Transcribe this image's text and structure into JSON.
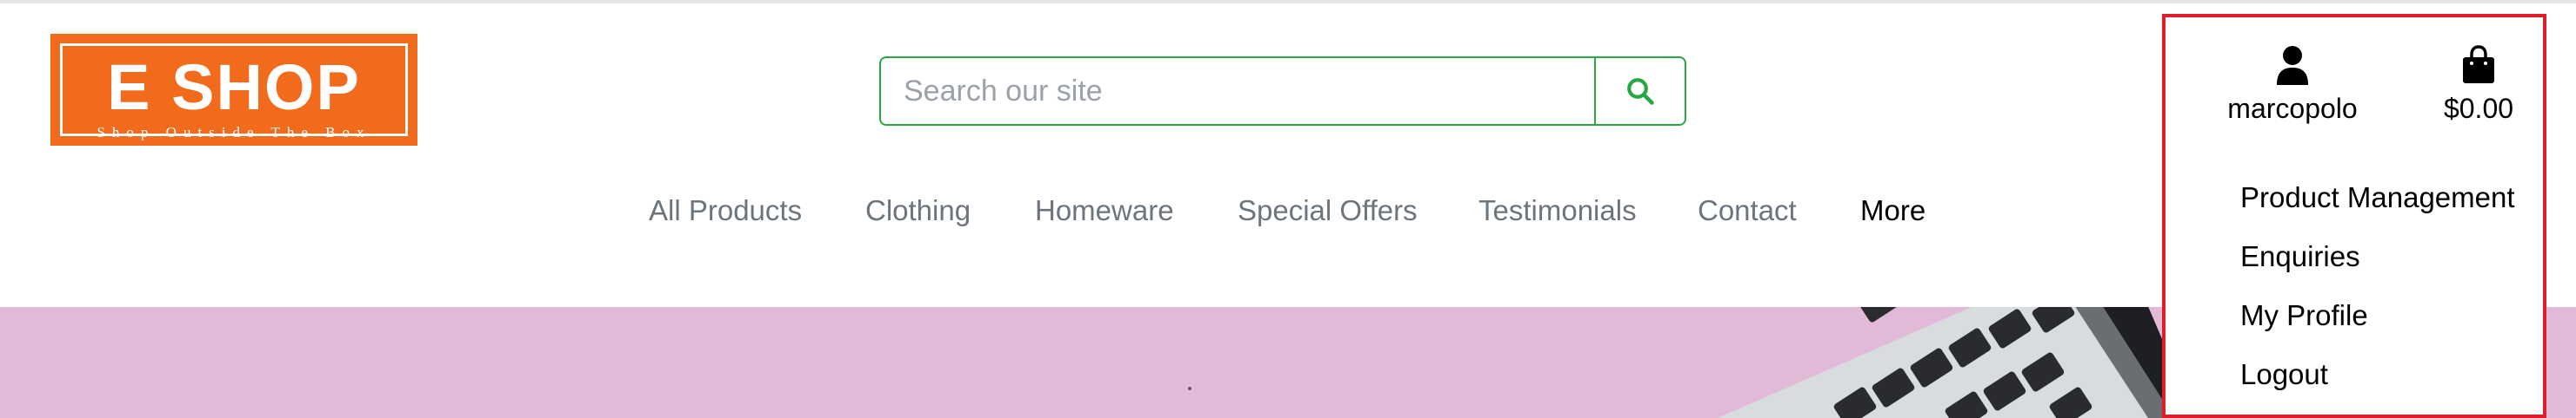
{
  "logo": {
    "title": "E SHOP",
    "tagline": "Shop Outside The Box",
    "brand_color": "#f26b1d"
  },
  "search": {
    "placeholder": "Search our site",
    "value": "",
    "button_icon": "search-icon",
    "accent_color": "#28a745"
  },
  "nav": {
    "items": [
      {
        "label": "All Products"
      },
      {
        "label": "Clothing"
      },
      {
        "label": "Homeware"
      },
      {
        "label": "Special Offers"
      },
      {
        "label": "Testimonials"
      },
      {
        "label": "Contact"
      },
      {
        "label": "More"
      }
    ]
  },
  "account": {
    "icon": "user-icon",
    "username": "marcopolo",
    "menu": [
      {
        "label": "Product Management"
      },
      {
        "label": "Enquiries"
      },
      {
        "label": "My Profile"
      },
      {
        "label": "Logout"
      }
    ]
  },
  "bag": {
    "icon": "shopping-bag-icon",
    "total": "$0.00"
  },
  "colors": {
    "highlight_border": "#e01e2b",
    "hero_background": "#e2b9d7",
    "nav_text": "#6c757d"
  }
}
